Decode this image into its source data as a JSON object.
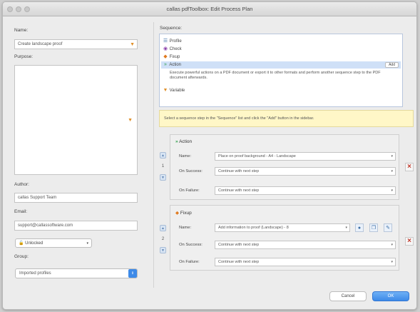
{
  "window": {
    "title": "callas pdfToolbox: Edit Process Plan"
  },
  "left": {
    "name_label": "Name:",
    "name_value": "Create landscape proof",
    "purpose_label": "Purpose:",
    "author_label": "Author:",
    "author_value": "callas Support Team",
    "email_label": "Email:",
    "email_value": "support@callassoftware.com",
    "lock_value": "Unlocked",
    "group_label": "Group:",
    "group_value": "Imported profiles"
  },
  "sequence": {
    "label": "Sequence:",
    "items": [
      {
        "label": "Profile",
        "icon": "profile-icon"
      },
      {
        "label": "Check",
        "icon": "check-icon"
      },
      {
        "label": "Fixup",
        "icon": "fixup-icon"
      },
      {
        "label": "Action",
        "icon": "action-icon"
      }
    ],
    "add_label": "Add",
    "description": "Execute powerful actions on a PDF document or export it to other formats and perform another sequence step to the PDF document afterwards.",
    "variable_label": "Variable",
    "hint": "Select a sequence step in the \"Sequence\" list and click the \"Add\" button in the sidebar."
  },
  "steps": [
    {
      "number": "1",
      "type": "Action",
      "name_label": "Name:",
      "name_value": "Place on proof background - A4 - Landscape",
      "success_label": "On Success:",
      "success_value": "Continue with next step",
      "failure_label": "On Failure:",
      "failure_value": "Continue with next step"
    },
    {
      "number": "2",
      "type": "Fixup",
      "name_label": "Name:",
      "name_value": "Add information to proof (Landscape) - 8",
      "success_label": "On Success:",
      "success_value": "Continue with next step",
      "failure_label": "On Failure:",
      "failure_value": "Continue with next step"
    }
  ],
  "footer": {
    "cancel_label": "Cancel",
    "ok_label": "OK"
  },
  "colors": {
    "accent": "#3d8ae8",
    "orange": "#e0902a",
    "delete": "#c0392b",
    "hint_bg": "#fff7c7"
  }
}
